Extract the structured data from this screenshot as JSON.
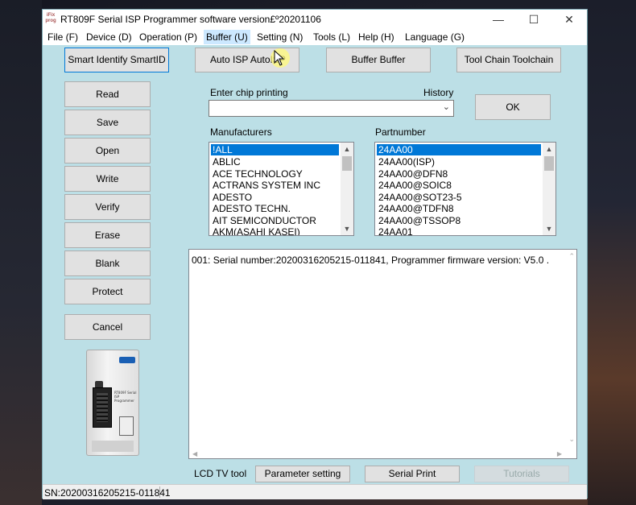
{
  "window": {
    "title": "RT809F Serial ISP Programmer software version£º20201106",
    "logo_text": "iFix prog",
    "controls": {
      "minimize": "—",
      "maximize": "☐",
      "close": "✕"
    }
  },
  "menu": [
    "File (F)",
    "Device (D)",
    "Operation (P)",
    "Buffer (U)",
    "Setting (N)",
    "Tools (L)",
    "Help (H)",
    "Language (G)"
  ],
  "top_buttons": {
    "smart_identify": "Smart Identify SmartID",
    "auto_isp": "Auto ISP AutoISP",
    "buffer": "Buffer Buffer",
    "tool_chain": "Tool Chain Toolchain"
  },
  "side_buttons": [
    "Read",
    "Save",
    "Open",
    "Write",
    "Verify",
    "Erase",
    "Blank",
    "Protect"
  ],
  "cancel_button": "Cancel",
  "chip": {
    "label": "Enter chip printing",
    "history_label": "History",
    "value": "",
    "ok_button": "OK"
  },
  "manufacturers": {
    "label": "Manufacturers",
    "items": [
      "!ALL",
      "ABLIC",
      "ACE TECHNOLOGY",
      "ACTRANS SYSTEM INC",
      "ADESTO",
      "ADESTO TECHN.",
      "AIT SEMICONDUCTOR",
      "AKM(ASAHI KASEI)"
    ],
    "selected_index": 0
  },
  "partnumber": {
    "label": "Partnumber",
    "items": [
      "24AA00",
      "24AA00(ISP)",
      "24AA00@DFN8",
      "24AA00@SOIC8",
      "24AA00@SOT23-5",
      "24AA00@TDFN8",
      "24AA00@TSSOP8",
      "24AA01"
    ],
    "selected_index": 0
  },
  "log": {
    "lines": [
      "001:  Serial number:20200316205215-011841, Programmer firmware version: V5.0 ."
    ]
  },
  "bottom": {
    "lcd_label": "LCD TV tool",
    "parameter_setting": "Parameter setting",
    "serial_print": "Serial Print",
    "tutorials": "Tutorials"
  },
  "device_image": {
    "badge_text": "RT809F Serial ISP Programmer"
  },
  "status": {
    "serial": "SN:20200316205215-011841"
  },
  "colors": {
    "window_bg": "#bcdfe6",
    "selection": "#0078d7",
    "cursor_highlight": "#fffa78"
  }
}
